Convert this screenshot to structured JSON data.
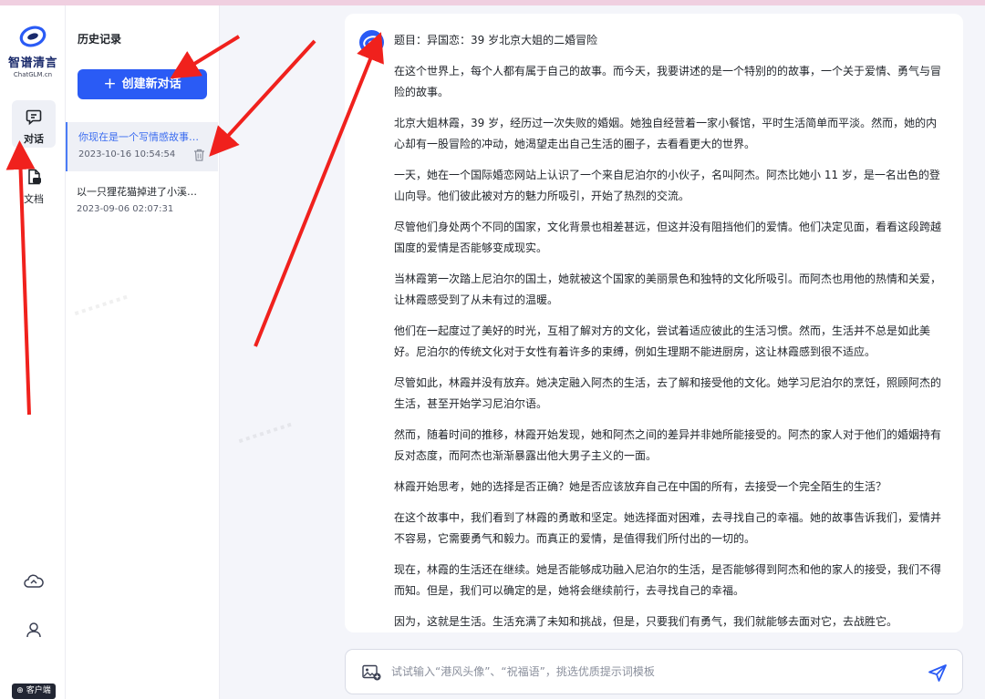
{
  "brand": {
    "name": "智谱清言",
    "domain": "ChatGLM.cn",
    "color": "#2a5bf5"
  },
  "rail": {
    "items": [
      {
        "label": "对话",
        "icon": "chat-icon",
        "active": true
      },
      {
        "label": "文档",
        "icon": "document-icon",
        "active": false
      }
    ],
    "bottom_icons": [
      "cloud-upload-icon",
      "user-icon"
    ],
    "client_label": "客户端"
  },
  "history": {
    "title": "历史记录",
    "new_chat_label": "创建新对话",
    "items": [
      {
        "title": "你现在是一个写情感故事的...",
        "date": "2023-10-16 10:54:54",
        "active": true
      },
      {
        "title": "以一只狸花猫掉进了小溪里...",
        "date": "2023-09-06 02:07:31",
        "active": false
      }
    ]
  },
  "message": {
    "title": "题目：异国恋：39 岁北京大姐的二婚冒险",
    "paragraphs": [
      "在这个世界上，每个人都有属于自己的故事。而今天，我要讲述的是一个特别的的故事，一个关于爱情、勇气与冒险的故事。",
      "北京大姐林霞，39 岁，经历过一次失败的婚姻。她独自经营着一家小餐馆，平时生活简单而平淡。然而，她的内心却有一股冒险的冲动，她渴望走出自己生活的圈子，去看看更大的世界。",
      "一天，她在一个国际婚恋网站上认识了一个来自尼泊尔的小伙子，名叫阿杰。阿杰比她小 11 岁，是一名出色的登山向导。他们彼此被对方的魅力所吸引，开始了热烈的交流。",
      "尽管他们身处两个不同的国家，文化背景也相差甚远，但这并没有阻挡他们的爱情。他们决定见面，看看这段跨越国度的爱情是否能够变成现实。",
      "当林霞第一次踏上尼泊尔的国土，她就被这个国家的美丽景色和独特的文化所吸引。而阿杰也用他的热情和关爱，让林霞感受到了从未有过的温暖。",
      "他们在一起度过了美好的时光，互相了解对方的文化，尝试着适应彼此的生活习惯。然而，生活并不总是如此美好。尼泊尔的传统文化对于女性有着许多的束缚，例如生理期不能进厨房，这让林霞感到很不适应。",
      "尽管如此，林霞并没有放弃。她决定融入阿杰的生活，去了解和接受他的文化。她学习尼泊尔的烹饪，照顾阿杰的生活，甚至开始学习尼泊尔语。",
      "然而，随着时间的推移，林霞开始发现，她和阿杰之间的差异并非她所能接受的。阿杰的家人对于他们的婚姻持有反对态度，而阿杰也渐渐暴露出他大男子主义的一面。",
      "林霞开始思考，她的选择是否正确？她是否应该放弃自己在中国的所有，去接受一个完全陌生的生活？",
      "在这个故事中，我们看到了林霞的勇敢和坚定。她选择面对困难，去寻找自己的幸福。她的故事告诉我们，爱情并不容易，它需要勇气和毅力。而真正的爱情，是值得我们所付出的一切的。",
      "现在，林霞的生活还在继续。她是否能够成功融入尼泊尔的生活，是否能够得到阿杰和他的家人的接受，我们不得而知。但是，我们可以确定的是，她将会继续前行，去寻找自己的幸福。",
      "因为，这就是生活。生活充满了未知和挑战，但是，只要我们有勇气，我们就能够去面对它，去战胜它。"
    ]
  },
  "input": {
    "value": "",
    "placeholder": "试试输入“港风头像”、“祝福语”，挑选优质提示词模板"
  },
  "annotation": {
    "arrow_color": "#f0211d"
  }
}
